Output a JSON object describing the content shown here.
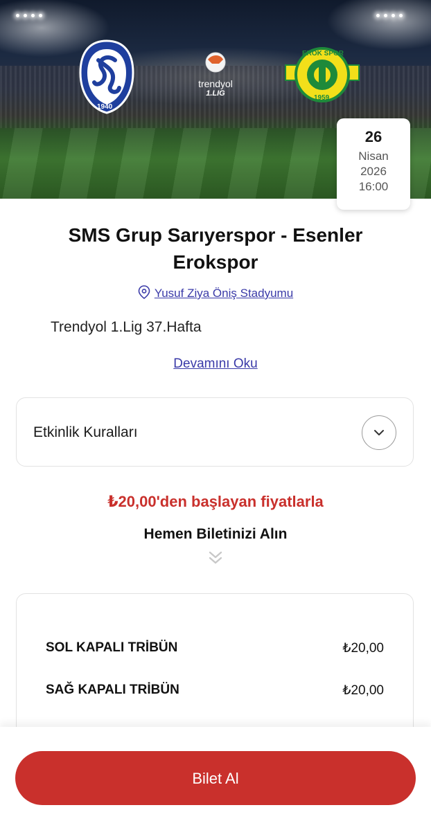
{
  "event": {
    "date": {
      "day": "26",
      "month": "Nisan",
      "year": "2026",
      "time": "16:00"
    },
    "title": "SMS Grup Sarıyerspor - Esenler Erokspor",
    "venue": "Yusuf Ziya Öniş Stadyumu",
    "league": "Trendyol 1.Lig 37.Hafta",
    "read_more": "Devamını Oku"
  },
  "home_logo": {
    "text_ring": "SARIYER SPOR KULÜBÜ",
    "year": "1940",
    "color": "#1f3f9e"
  },
  "league_logo": {
    "line1": "trendyol",
    "line2": "1.LIG"
  },
  "away_logo": {
    "text": "EROK SPOR",
    "year": "1959",
    "color_primary": "#f2df1a",
    "color_secondary": "#1e8a3a"
  },
  "rules": {
    "label": "Etkinlik Kuralları",
    "icon": "chevron-down-icon"
  },
  "pricing": {
    "from_text": "₺20,00'den başlayan fiyatlarla",
    "cta": "Hemen Biletinizi Alın",
    "sections": [
      {
        "name": "SOL KAPALI TRİBÜN",
        "price": "₺20,00"
      },
      {
        "name": "SAĞ KAPALI TRİBÜN",
        "price": "₺20,00"
      }
    ]
  },
  "buy_button": {
    "label": "Bilet Al"
  },
  "colors": {
    "accent": "#c9302c",
    "link": "#3a3aa8"
  }
}
